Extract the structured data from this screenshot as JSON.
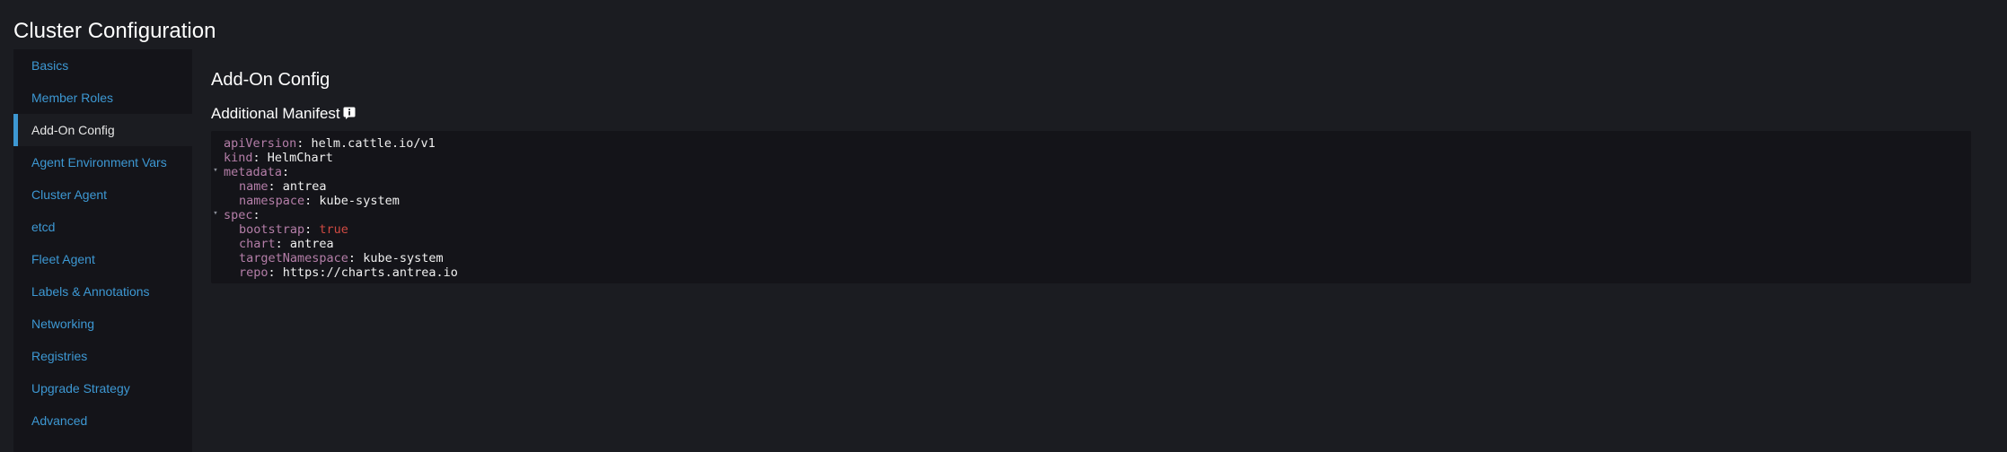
{
  "page": {
    "title": "Cluster Configuration"
  },
  "sidebar": {
    "items": [
      {
        "label": "Basics",
        "active": false
      },
      {
        "label": "Member Roles",
        "active": false
      },
      {
        "label": "Add-On Config",
        "active": true
      },
      {
        "label": "Agent Environment Vars",
        "active": false
      },
      {
        "label": "Cluster Agent",
        "active": false
      },
      {
        "label": "etcd",
        "active": false
      },
      {
        "label": "Fleet Agent",
        "active": false
      },
      {
        "label": "Labels & Annotations",
        "active": false
      },
      {
        "label": "Networking",
        "active": false
      },
      {
        "label": "Registries",
        "active": false
      },
      {
        "label": "Upgrade Strategy",
        "active": false
      },
      {
        "label": "Advanced",
        "active": false
      }
    ]
  },
  "main": {
    "title": "Add-On Config",
    "manifest_heading": "Additional Manifest",
    "manifest_icon": "info-icon"
  },
  "editor": {
    "lines": [
      {
        "key": "apiVersion",
        "value": "helm.cattle.io/v1"
      },
      {
        "key": "kind",
        "value": "HelmChart"
      },
      {
        "key": "metadata",
        "value": "",
        "foldable": true
      },
      {
        "key": "name",
        "value": "antrea"
      },
      {
        "key": "namespace",
        "value": "kube-system"
      },
      {
        "key": "spec",
        "value": "",
        "foldable": true
      },
      {
        "key": "bootstrap",
        "value": "true"
      },
      {
        "key": "chart",
        "value": "antrea"
      },
      {
        "key": "targetNamespace",
        "value": "kube-system"
      },
      {
        "key": "repo",
        "value": "https://charts.antrea.io"
      }
    ]
  },
  "colors": {
    "link": "#3d98d3",
    "yaml_key": "#b47ea8",
    "yaml_bool": "#d04a42",
    "background": "#1b1c21",
    "panel": "#141419"
  }
}
